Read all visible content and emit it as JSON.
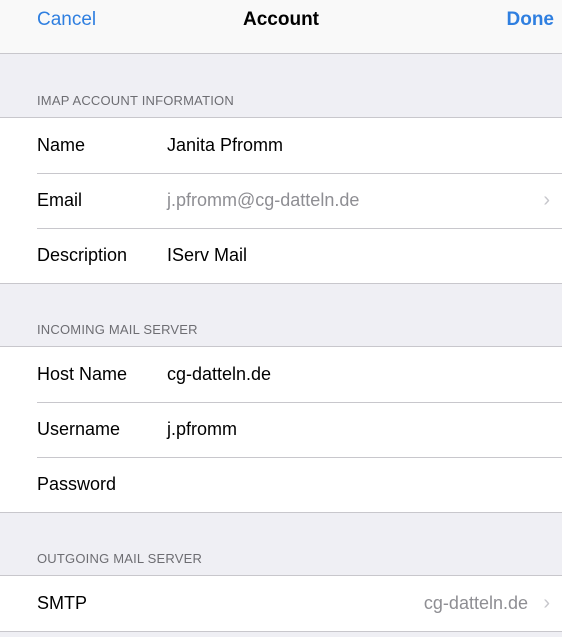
{
  "navbar": {
    "cancel_label": "Cancel",
    "title": "Account",
    "done_label": "Done"
  },
  "sections": {
    "imap": {
      "header": "IMAP ACCOUNT INFORMATION",
      "name_label": "Name",
      "name_value": "Janita Pfromm",
      "email_label": "Email",
      "email_value": "j.pfromm@cg-datteln.de",
      "description_label": "Description",
      "description_value": "IServ Mail"
    },
    "incoming": {
      "header": "INCOMING MAIL SERVER",
      "host_label": "Host Name",
      "host_value": "cg-datteln.de",
      "username_label": "Username",
      "username_value": "j.pfromm",
      "password_label": "Password",
      "password_value": ""
    },
    "outgoing": {
      "header": "OUTGOING MAIL SERVER",
      "smtp_label": "SMTP",
      "smtp_value": "cg-datteln.de"
    }
  },
  "icons": {
    "chevron": "›"
  },
  "colors": {
    "accent": "#2f7fe0",
    "background": "#efeff4",
    "separator": "#c8c7cc",
    "secondary_text": "#8e8e93"
  }
}
